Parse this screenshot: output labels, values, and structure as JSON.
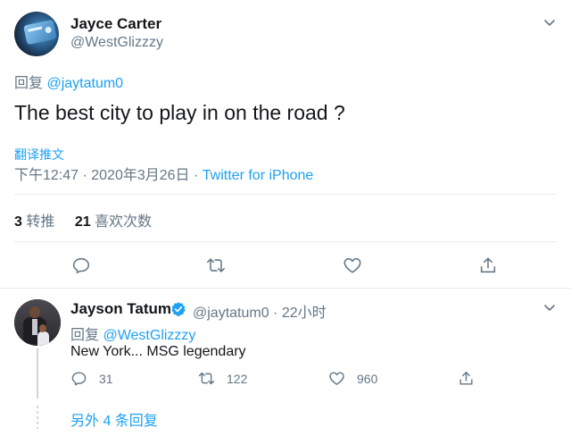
{
  "colors": {
    "accent": "#1da1f2",
    "secondary_text": "#657786",
    "primary_text": "#14171a",
    "divider": "#e6ecf0",
    "verified": "#1da1f2"
  },
  "main_tweet": {
    "author_name": "Jayce Carter",
    "author_handle": "@WestGlizzzy",
    "reply_prefix": "回复",
    "reply_to_handle": "@jaytatum0",
    "text": "The best city to play in on the road ?",
    "translate_label": "翻译推文",
    "timestamp": "下午12:47 · 2020年3月26日 · ",
    "source": "Twitter for iPhone",
    "stats": {
      "retweets_count": "3",
      "retweets_label": " 转推",
      "likes_count": "21",
      "likes_label": " 喜欢次数"
    },
    "actions": [
      "reply-icon",
      "retweet-icon",
      "like-icon",
      "share-icon"
    ]
  },
  "reply_tweet": {
    "author_name": "Jayson Tatum",
    "author_handle_time": "@jaytatum0 · 22小时",
    "reply_prefix": "回复",
    "reply_to_handle": "@WestGlizzzy",
    "text": "New York... MSG legendary",
    "reply_count": "31",
    "retweet_count": "122",
    "like_count": "960",
    "more_replies": "另外 4 条回复"
  }
}
